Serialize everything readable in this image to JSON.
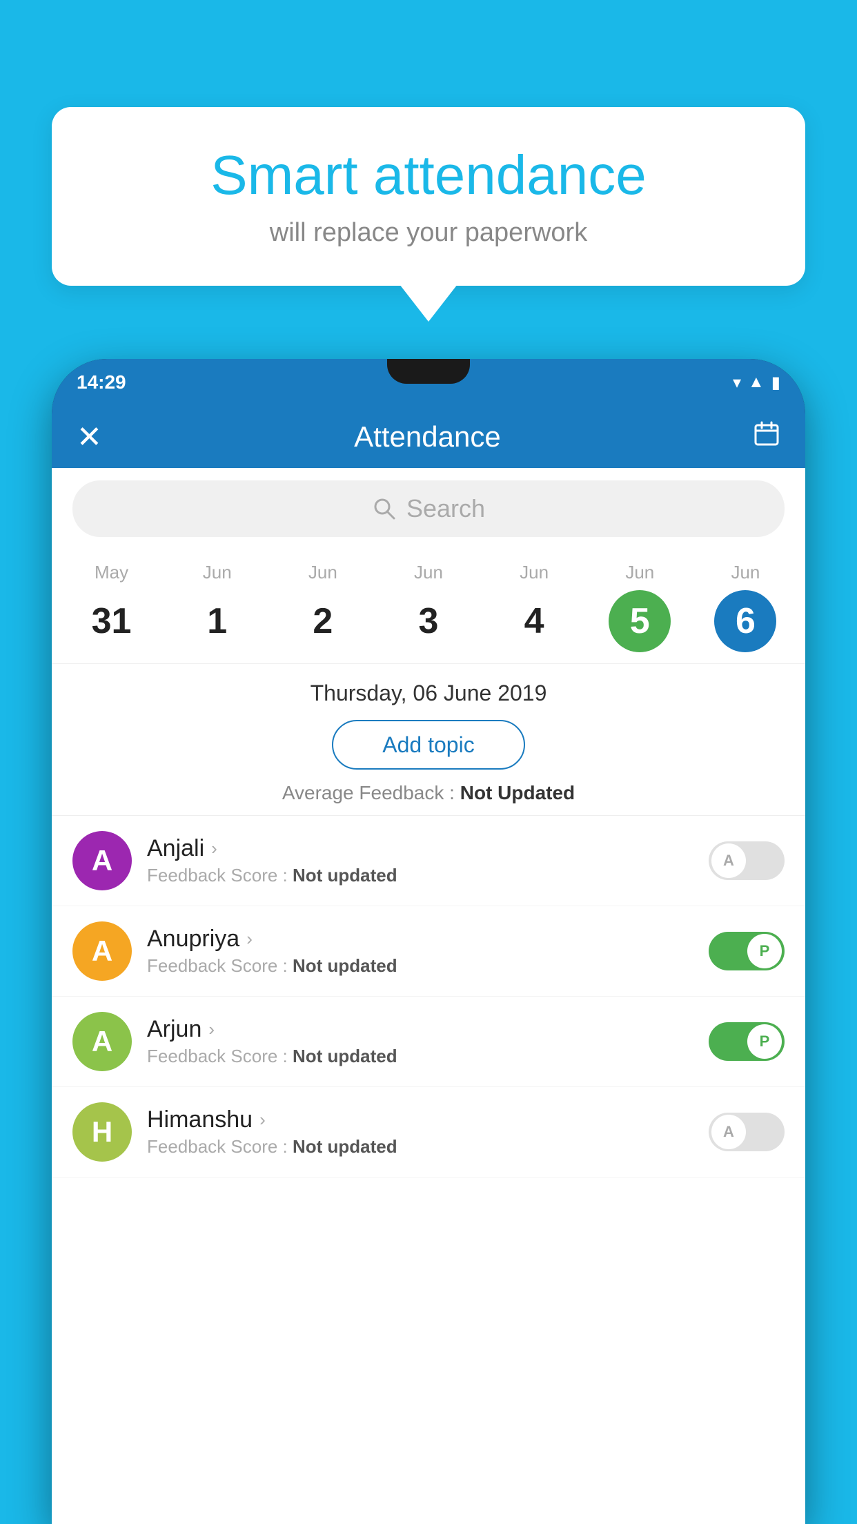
{
  "background_color": "#1ab8e8",
  "bubble": {
    "title": "Smart attendance",
    "subtitle": "will replace your paperwork"
  },
  "status_bar": {
    "time": "14:29",
    "icons": [
      "wifi",
      "signal",
      "battery"
    ]
  },
  "toolbar": {
    "title": "Attendance",
    "close_label": "✕",
    "calendar_label": "📅"
  },
  "search": {
    "placeholder": "Search"
  },
  "calendar": {
    "days": [
      {
        "month": "May",
        "date": "31",
        "state": "normal"
      },
      {
        "month": "Jun",
        "date": "1",
        "state": "normal"
      },
      {
        "month": "Jun",
        "date": "2",
        "state": "normal"
      },
      {
        "month": "Jun",
        "date": "3",
        "state": "normal"
      },
      {
        "month": "Jun",
        "date": "4",
        "state": "normal"
      },
      {
        "month": "Jun",
        "date": "5",
        "state": "today"
      },
      {
        "month": "Jun",
        "date": "6",
        "state": "selected"
      }
    ]
  },
  "selected_date_label": "Thursday, 06 June 2019",
  "add_topic_label": "Add topic",
  "average_feedback": {
    "label": "Average Feedback : ",
    "value": "Not Updated"
  },
  "students": [
    {
      "name": "Anjali",
      "avatar_letter": "A",
      "avatar_color": "#9c27b0",
      "feedback_label": "Feedback Score : ",
      "feedback_value": "Not updated",
      "toggle": "off",
      "toggle_letter": "A"
    },
    {
      "name": "Anupriya",
      "avatar_letter": "A",
      "avatar_color": "#f5a623",
      "feedback_label": "Feedback Score : ",
      "feedback_value": "Not updated",
      "toggle": "on",
      "toggle_letter": "P"
    },
    {
      "name": "Arjun",
      "avatar_letter": "A",
      "avatar_color": "#8bc34a",
      "feedback_label": "Feedback Score : ",
      "feedback_value": "Not updated",
      "toggle": "on",
      "toggle_letter": "P"
    },
    {
      "name": "Himanshu",
      "avatar_letter": "H",
      "avatar_color": "#a5c44b",
      "feedback_label": "Feedback Score : ",
      "feedback_value": "Not updated",
      "toggle": "off",
      "toggle_letter": "A"
    }
  ]
}
